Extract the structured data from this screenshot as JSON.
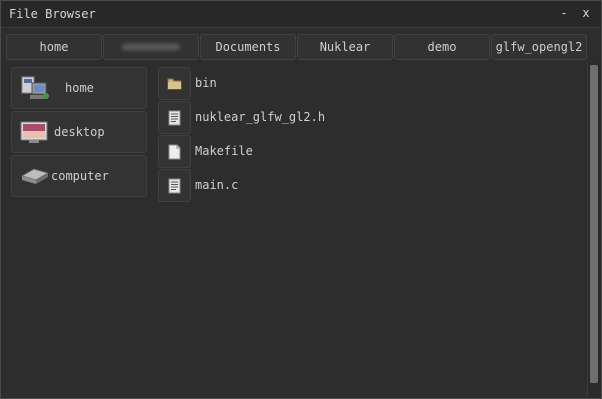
{
  "window": {
    "title": "File Browser",
    "minimize_label": "-",
    "close_label": "x"
  },
  "path": {
    "crumbs": [
      {
        "label": "home",
        "icon": "",
        "obscured": false
      },
      {
        "label": "",
        "icon": "",
        "obscured": true
      },
      {
        "label": "Documents",
        "icon": "",
        "obscured": false
      },
      {
        "label": "Nuklear",
        "icon": "",
        "obscured": false
      },
      {
        "label": "demo",
        "icon": "",
        "obscured": false
      },
      {
        "label": "glfw_opengl2",
        "icon": "",
        "obscured": false
      }
    ]
  },
  "sidebar": {
    "items": [
      {
        "label": "home",
        "icon": "home-computer-icon"
      },
      {
        "label": "desktop",
        "icon": "desktop-icon"
      },
      {
        "label": "computer",
        "icon": "hard-drive-icon"
      }
    ]
  },
  "files": {
    "items": [
      {
        "name": "bin",
        "icon": "folder-icon"
      },
      {
        "name": "nuklear_glfw_gl2.h",
        "icon": "text-file-icon"
      },
      {
        "name": "Makefile",
        "icon": "default-file-icon"
      },
      {
        "name": "main.c",
        "icon": "text-file-icon"
      }
    ]
  }
}
